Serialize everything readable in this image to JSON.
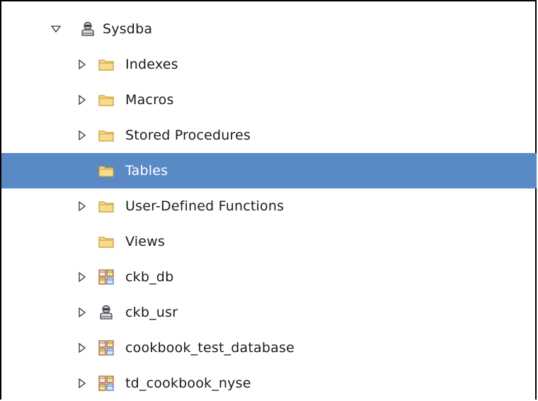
{
  "tree": {
    "root": {
      "label": "Sysdba",
      "icon": "user-icon",
      "expanded": true
    },
    "children": [
      {
        "label": "Indexes",
        "icon": "folder-icon",
        "expandable": true
      },
      {
        "label": "Macros",
        "icon": "folder-icon",
        "expandable": true
      },
      {
        "label": "Stored Procedures",
        "icon": "folder-icon",
        "expandable": true
      },
      {
        "label": "Tables",
        "icon": "folder-icon",
        "expandable": false,
        "selected": true
      },
      {
        "label": "User-Defined Functions",
        "icon": "folder-icon",
        "expandable": true
      },
      {
        "label": "Views",
        "icon": "folder-icon",
        "expandable": false
      },
      {
        "label": "ckb_db",
        "icon": "database-icon",
        "expandable": true
      },
      {
        "label": "ckb_usr",
        "icon": "user-icon",
        "expandable": true
      },
      {
        "label": "cookbook_test_database",
        "icon": "database-icon",
        "expandable": true
      },
      {
        "label": "td_cookbook_nyse",
        "icon": "database-icon",
        "expandable": true
      }
    ]
  },
  "colors": {
    "selection": "#5a8ac6",
    "folder_fill": "#f7dc8c",
    "folder_stroke": "#c89a32"
  }
}
